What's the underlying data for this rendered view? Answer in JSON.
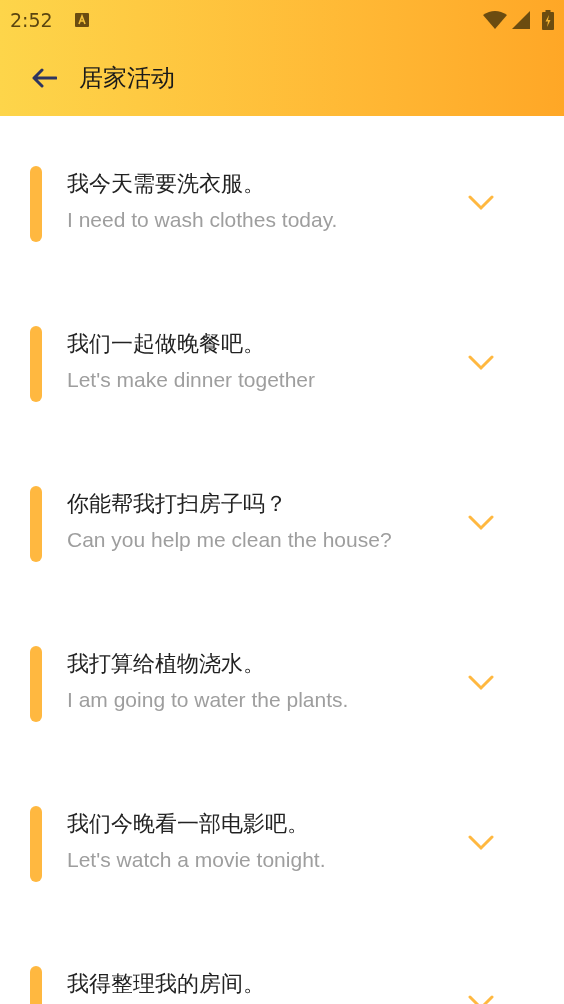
{
  "status_bar": {
    "time": "2:52"
  },
  "app_bar": {
    "title": "居家活动"
  },
  "phrases": [
    {
      "chinese": "我今天需要洗衣服。",
      "english": "I need to wash clothes today.",
      "expanded": false
    },
    {
      "chinese": "我们一起做晚餐吧。",
      "english": "Let's make dinner together",
      "expanded": false
    },
    {
      "chinese": "你能帮我打扫房子吗？",
      "english": "Can you help me clean the house?",
      "expanded": false
    },
    {
      "chinese": "我打算给植物浇水。",
      "english": "I am going to water the plants.",
      "expanded": false
    },
    {
      "chinese": "我们今晚看一部电影吧。",
      "english": "Let's watch a movie tonight.",
      "expanded": false
    },
    {
      "chinese": "我得整理我的房间。",
      "expanded": false
    }
  ]
}
